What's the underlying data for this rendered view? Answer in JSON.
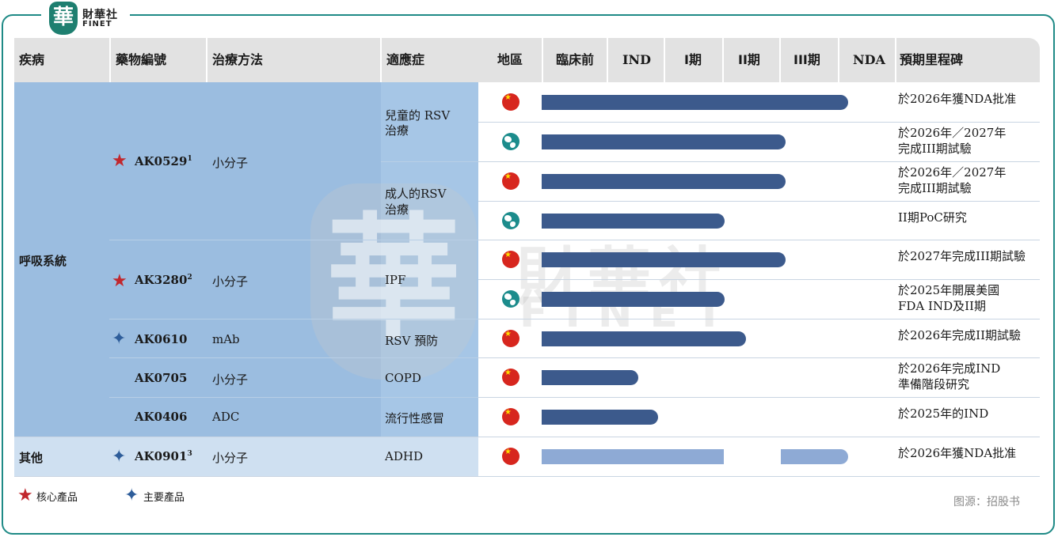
{
  "logo": {
    "mark": "華",
    "name_cn": "財華社",
    "name_en": "FINET"
  },
  "header": {
    "disease": "疾病",
    "drug_code": "藥物編號",
    "modality": "治療方法",
    "indication": "適應症",
    "region": "地區",
    "preclinical": "臨床前",
    "ind": "IND",
    "phase1": "I期",
    "phase2": "II期",
    "phase3": "III期",
    "nda": "NDA",
    "milestone": "預期里程碑"
  },
  "groups": {
    "respiratory": "呼吸系統",
    "other": "其他"
  },
  "drugs": [
    {
      "code": "AK0529",
      "sup": "1",
      "marker": "core",
      "modality": "小分子"
    },
    {
      "code": "AK3280",
      "sup": "2",
      "marker": "core",
      "modality": "小分子"
    },
    {
      "code": "AK0610",
      "sup": "",
      "marker": "main",
      "modality": "mAb"
    },
    {
      "code": "AK0705",
      "sup": "",
      "marker": "",
      "modality": "小分子"
    },
    {
      "code": "AK0406",
      "sup": "",
      "marker": "",
      "modality": "ADC"
    },
    {
      "code": "AK0901",
      "sup": "3",
      "marker": "main",
      "modality": "小分子"
    }
  ],
  "indications": {
    "pediatric_rsv_1": "兒童的 RSV",
    "pediatric_rsv_2": "治療",
    "adult_rsv_1": "成人的RSV",
    "adult_rsv_2": "治療",
    "ipf": "IPF",
    "rsv_prevention": "RSV 預防",
    "copd": "COPD",
    "influenza": "流行性感冒",
    "adhd": "ADHD"
  },
  "rows": [
    {
      "region": "china",
      "stage": "NDA",
      "milestone": [
        "於2026年獲NDA批准"
      ]
    },
    {
      "region": "global",
      "stage": "III期",
      "milestone": [
        "於2026年／2027年",
        "完成III期試驗"
      ]
    },
    {
      "region": "china",
      "stage": "III期",
      "milestone": [
        "於2026年／2027年",
        "完成III期試驗"
      ]
    },
    {
      "region": "global",
      "stage": "II期",
      "milestone": [
        "II期PoC研究"
      ]
    },
    {
      "region": "china",
      "stage": "III期",
      "milestone": [
        "於2027年完成III期試驗"
      ]
    },
    {
      "region": "global",
      "stage": "II期",
      "milestone": [
        "於2025年開展美國",
        "FDA IND及II期"
      ]
    },
    {
      "region": "china",
      "stage": "II期",
      "milestone": [
        "於2026年完成II期試驗"
      ]
    },
    {
      "region": "china",
      "stage": "IND",
      "milestone": [
        "於2026年完成IND",
        "準備階段研究"
      ]
    },
    {
      "region": "china",
      "stage": "IND",
      "milestone": [
        "於2025年的IND"
      ]
    },
    {
      "region": "china",
      "stage": "NDA",
      "milestone": [
        "於2026年獲NDA批准"
      ]
    }
  ],
  "legend": {
    "core": "核心產品",
    "main": "主要產品"
  },
  "source": "图源：招股书",
  "colors": {
    "bar_dark": "#3c5a8c",
    "bar_light": "#8eaad5",
    "band": "#9bbde0",
    "frame": "#1f8a86",
    "star_core": "#c1272d",
    "star_main": "#2e5d9a"
  },
  "icons": {
    "china": "china-flag-icon",
    "global": "globe-icon",
    "core": "red-star-icon",
    "main": "blue-sparkle-icon"
  }
}
